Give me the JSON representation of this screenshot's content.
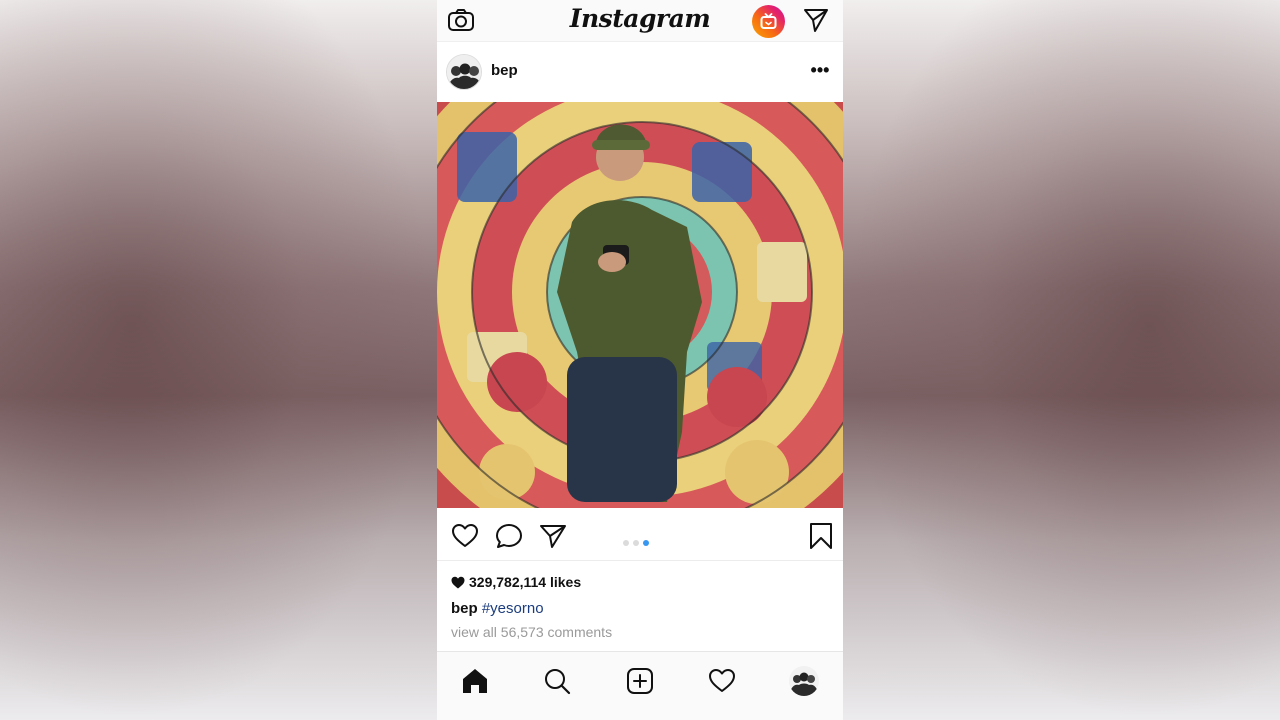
{
  "app": {
    "name": "Instagram"
  },
  "topbar": {
    "camera_icon": "camera-icon",
    "igtv_icon": "igtv-icon",
    "direct_icon": "paper-plane-icon"
  },
  "post": {
    "username": "bep",
    "more_icon": "more-horizontal-icon",
    "carousel": {
      "total": 3,
      "active_index": 2
    },
    "likes": "329,782,114 likes",
    "caption_user": "bep",
    "caption_hashtag": "#yesorno",
    "comments_link": "view all 56,573 comments"
  },
  "colors": {
    "accent_blue": "#3897f0",
    "hashtag": "#1c3d7d",
    "muted": "#9a9a9a"
  },
  "bottom_nav": {
    "items": [
      "home-icon",
      "search-icon",
      "add-post-icon",
      "activity-heart-icon",
      "profile-avatar"
    ]
  }
}
